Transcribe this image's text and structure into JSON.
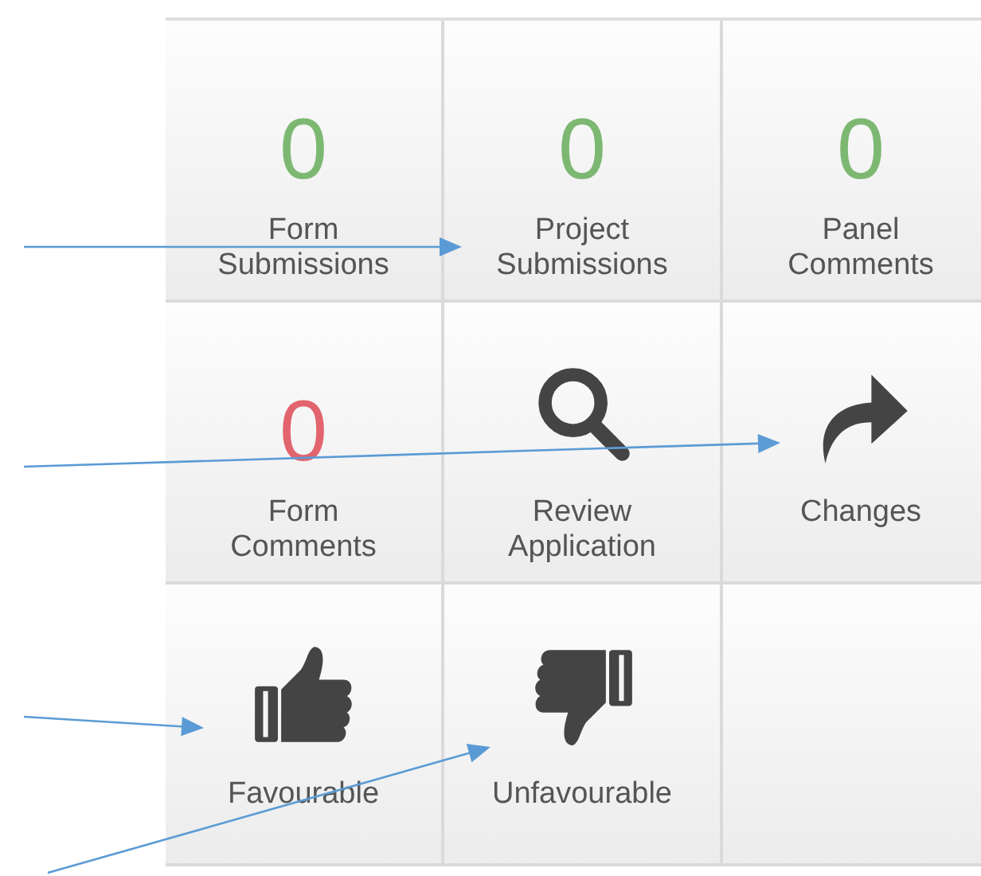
{
  "tiles": [
    {
      "kind": "count",
      "count": "0",
      "color": "#7db873",
      "label_lines": [
        "Form",
        "Submissions"
      ]
    },
    {
      "kind": "count",
      "count": "0",
      "color": "#7db873",
      "label_lines": [
        "Project",
        "Submissions"
      ]
    },
    {
      "kind": "count",
      "count": "0",
      "color": "#7db873",
      "label_lines": [
        "Panel",
        "Comments"
      ]
    },
    {
      "kind": "count",
      "count": "0",
      "color": "#e2646e",
      "label_lines": [
        "Form",
        "Comments"
      ]
    },
    {
      "kind": "search",
      "label_lines": [
        "Review",
        "Application"
      ]
    },
    {
      "kind": "forward",
      "label_lines": [
        "Changes"
      ]
    },
    {
      "kind": "like",
      "label_lines": [
        "Favourable"
      ]
    },
    {
      "kind": "dislike",
      "label_lines": [
        "Unfavourable"
      ]
    },
    {
      "kind": "empty"
    }
  ]
}
